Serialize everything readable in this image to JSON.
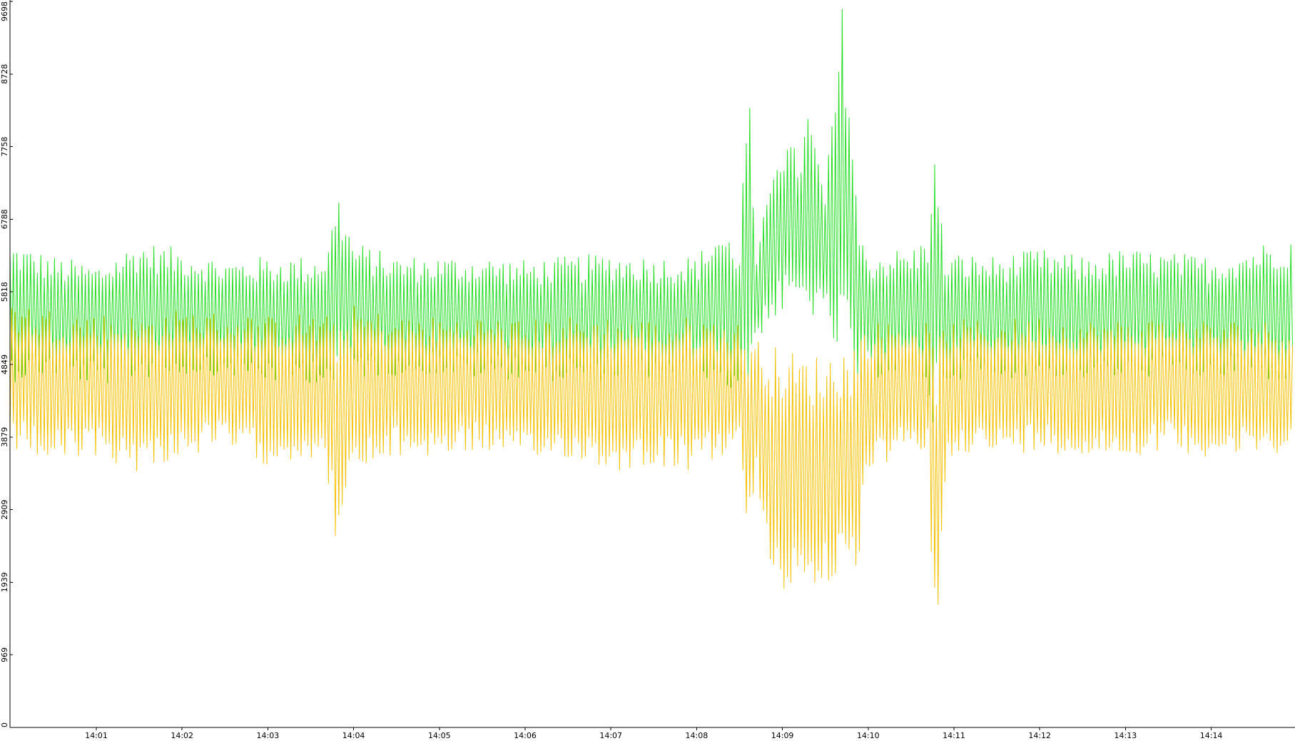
{
  "chart_data": {
    "type": "line",
    "title": "",
    "xlabel": "",
    "ylabel": "",
    "ylim": [
      0,
      9698
    ],
    "xlim_minutes": [
      14.0,
      15.0
    ],
    "y_ticks": [
      "0",
      "969",
      "1939",
      "2909",
      "3879",
      "4849",
      "5818",
      "6788",
      "7758",
      "8728",
      "9698"
    ],
    "x_ticks": [
      {
        "label": "14:01",
        "min": 1
      },
      {
        "label": "14:02",
        "min": 2
      },
      {
        "label": "14:03",
        "min": 3
      },
      {
        "label": "14:04",
        "min": 4
      },
      {
        "label": "14:05",
        "min": 5
      },
      {
        "label": "14:06",
        "min": 6
      },
      {
        "label": "14:07",
        "min": 7
      },
      {
        "label": "14:08",
        "min": 8
      },
      {
        "label": "14:09",
        "min": 9
      },
      {
        "label": "14:10",
        "min": 10
      },
      {
        "label": "14:11",
        "min": 11
      },
      {
        "label": "14:12",
        "min": 12
      },
      {
        "label": "14:13",
        "min": 13
      },
      {
        "label": "14:14",
        "min": 14
      }
    ],
    "grid": false,
    "legend": "none",
    "series": [
      {
        "color": "#22dd22",
        "x_min": [
          0.0,
          0.5,
          1.0,
          1.5,
          2.0,
          2.5,
          3.0,
          3.5,
          3.7,
          3.8,
          4.0,
          4.5,
          5.0,
          5.5,
          6.0,
          6.5,
          7.0,
          7.5,
          8.0,
          8.25,
          8.5,
          8.6,
          8.7,
          8.9,
          9.0,
          9.2,
          9.3,
          9.5,
          9.7,
          9.75,
          9.8,
          9.9,
          10.0,
          10.3,
          10.5,
          10.7,
          10.75,
          10.8,
          10.9,
          11.0,
          11.5,
          12.0,
          12.5,
          13.0,
          13.5,
          14.0,
          14.5,
          14.95,
          15.0
        ],
        "upper": [
          6500,
          6300,
          6200,
          6500,
          6400,
          6250,
          6300,
          6300,
          6400,
          7250,
          6500,
          6300,
          6300,
          6300,
          6250,
          6300,
          6350,
          6300,
          6300,
          6700,
          6500,
          8800,
          6200,
          7800,
          7900,
          7700,
          8300,
          7200,
          9698,
          9000,
          8400,
          6600,
          6350,
          6400,
          6400,
          6600,
          8000,
          7400,
          6300,
          6350,
          6300,
          6400,
          6300,
          6400,
          6350,
          6300,
          6450,
          6600,
          6200
        ],
        "lower": [
          4600,
          4700,
          4550,
          4650,
          4700,
          4700,
          4600,
          4600,
          4600,
          4400,
          4650,
          4700,
          4700,
          4650,
          4650,
          4600,
          4650,
          4650,
          4700,
          4600,
          4400,
          4500,
          5200,
          5400,
          5500,
          5600,
          5500,
          5400,
          4700,
          5300,
          4500,
          4600,
          4650,
          4700,
          4650,
          4600,
          3700,
          4300,
          4600,
          4650,
          4650,
          4700,
          4650,
          4650,
          4700,
          4650,
          4650,
          4600,
          4550
        ]
      },
      {
        "color": "#f5c000",
        "x_min": [
          0.0,
          0.5,
          1.0,
          1.5,
          2.0,
          2.5,
          3.0,
          3.5,
          3.7,
          3.8,
          4.0,
          4.5,
          5.0,
          5.5,
          6.0,
          6.5,
          7.0,
          7.5,
          8.0,
          8.25,
          8.5,
          8.6,
          8.7,
          8.9,
          9.0,
          9.2,
          9.3,
          9.5,
          9.7,
          9.75,
          9.8,
          9.9,
          10.0,
          10.3,
          10.5,
          10.7,
          10.75,
          10.8,
          10.9,
          11.0,
          11.5,
          12.0,
          12.5,
          13.0,
          13.5,
          14.0,
          14.5,
          14.95,
          15.0
        ],
        "upper": [
          5700,
          5600,
          5550,
          5500,
          5600,
          5550,
          5500,
          5550,
          5500,
          5500,
          5650,
          5500,
          5500,
          5500,
          5450,
          5500,
          5500,
          5450,
          5500,
          5450,
          5400,
          5300,
          5200,
          5100,
          5100,
          5000,
          5000,
          5000,
          5100,
          5100,
          5200,
          5300,
          5400,
          5450,
          5450,
          5400,
          5300,
          5200,
          5400,
          5450,
          5450,
          5500,
          5450,
          5450,
          5500,
          5450,
          5450,
          5400,
          5300
        ],
        "lower": [
          3700,
          3500,
          3600,
          3400,
          3600,
          3700,
          3500,
          3600,
          3300,
          2400,
          3300,
          3600,
          3600,
          3700,
          3500,
          3600,
          3400,
          3500,
          3400,
          3600,
          3700,
          2400,
          3200,
          1900,
          1800,
          1800,
          1800,
          1900,
          1900,
          1800,
          1700,
          2300,
          3300,
          3600,
          3600,
          3700,
          1000,
          1100,
          3300,
          3700,
          3600,
          3700,
          3600,
          3600,
          3700,
          3600,
          3600,
          3700,
          2600
        ]
      }
    ]
  }
}
